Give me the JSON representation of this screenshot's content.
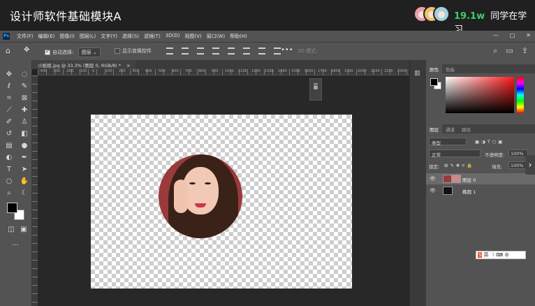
{
  "banner": {
    "title": "设计师软件基础模块A",
    "viewer_count": "19.1w",
    "viewer_label": "同学在学习"
  },
  "menubar": {
    "logo": "Ps",
    "items": [
      "文件(F)",
      "编辑(E)",
      "图像(I)",
      "图层(L)",
      "文字(Y)",
      "选择(S)",
      "滤镜(T)",
      "3D(D)",
      "视图(V)",
      "窗口(W)",
      "帮助(H)"
    ],
    "window_controls": [
      "—",
      "□",
      "✕"
    ]
  },
  "options": {
    "auto_select_label": "自动选择:",
    "auto_select_target": "图层",
    "show_transform_label": "显示变换控件",
    "mode_3d": "3D 模式:"
  },
  "document": {
    "tab_title": "小姐姐.jpg @ 33.3% (图层 0, RGB/8) *",
    "close": "×"
  },
  "ruler": {
    "labels": [
      "-400",
      "-300",
      "-200",
      "-100",
      "0",
      "100",
      "200",
      "300",
      "400",
      "500",
      "600",
      "700",
      "800",
      "900",
      "1000",
      "1100",
      "1200",
      "1300",
      "1400",
      "1500",
      "1600",
      "1700",
      "1800",
      "1900",
      "2000",
      "2100",
      "2200",
      "2300"
    ]
  },
  "panels": {
    "color_tabs": [
      "颜色",
      "色板"
    ],
    "layers_tabs": [
      "图层",
      "通道",
      "路径"
    ],
    "kind_filter": "类型",
    "blend_mode": "正常",
    "opacity_label": "不透明度:",
    "opacity_value": "100%",
    "lock_label": "锁定:",
    "fill_label": "填充:",
    "fill_value": "100%",
    "layers": [
      {
        "name": "图层 0"
      },
      {
        "name": "椭圆 1"
      }
    ]
  },
  "ime": {
    "brand": "S",
    "label": "英"
  },
  "colors": {
    "foreground": "#000000",
    "background": "#ffffff",
    "picker_hue": "#ff1a1a",
    "viewers_accent": "#3ccf6a"
  }
}
